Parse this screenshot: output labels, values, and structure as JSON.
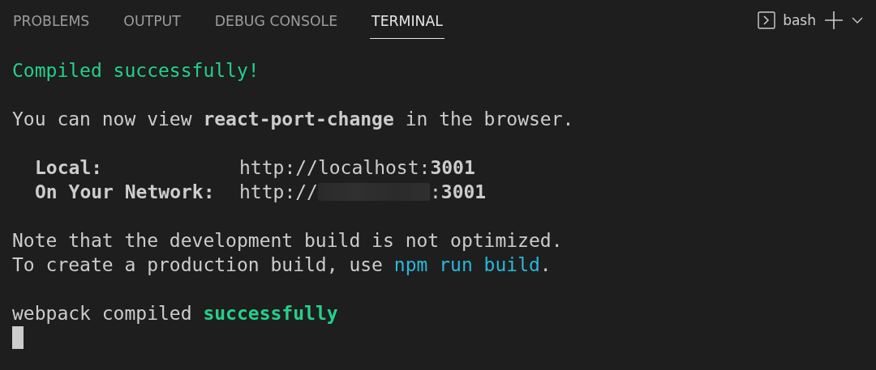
{
  "tabs": [
    {
      "label": "PROBLEMS",
      "selected": false
    },
    {
      "label": "OUTPUT",
      "selected": false
    },
    {
      "label": "DEBUG CONSOLE",
      "selected": false
    },
    {
      "label": "TERMINAL",
      "selected": true
    }
  ],
  "terminal_picker": {
    "label": "bash"
  },
  "terminal_lines": [
    {
      "kind": "text",
      "segments": [
        {
          "kind": "success",
          "text": "Compiled successfully!"
        }
      ]
    },
    {
      "kind": "blank"
    },
    {
      "kind": "text",
      "segments": [
        {
          "kind": "plain",
          "text": "You can now view "
        },
        {
          "kind": "bold",
          "text": "react-port-change"
        },
        {
          "kind": "plain",
          "text": " in the browser."
        }
      ]
    },
    {
      "kind": "blank"
    },
    {
      "kind": "address",
      "label": "Local:",
      "url": "http://localhost:**3001**"
    },
    {
      "kind": "address",
      "label": "On Your Network:",
      "url": "http://",
      "redacted": true,
      "port": ":**3001**"
    },
    {
      "kind": "blank"
    },
    {
      "kind": "text",
      "segments": [
        {
          "kind": "plain",
          "text": "Note that the development build is not optimized."
        }
      ]
    },
    {
      "kind": "text",
      "segments": [
        {
          "kind": "plain",
          "text": "To create a production build, use "
        },
        {
          "kind": "link",
          "text": "npm run build"
        },
        {
          "kind": "plain",
          "text": "."
        }
      ]
    },
    {
      "kind": "blank"
    },
    {
      "kind": "text",
      "segments": [
        {
          "kind": "plain",
          "text": "webpack compiled "
        },
        {
          "kind": "success-bold",
          "text": "successfully"
        }
      ]
    }
  ]
}
